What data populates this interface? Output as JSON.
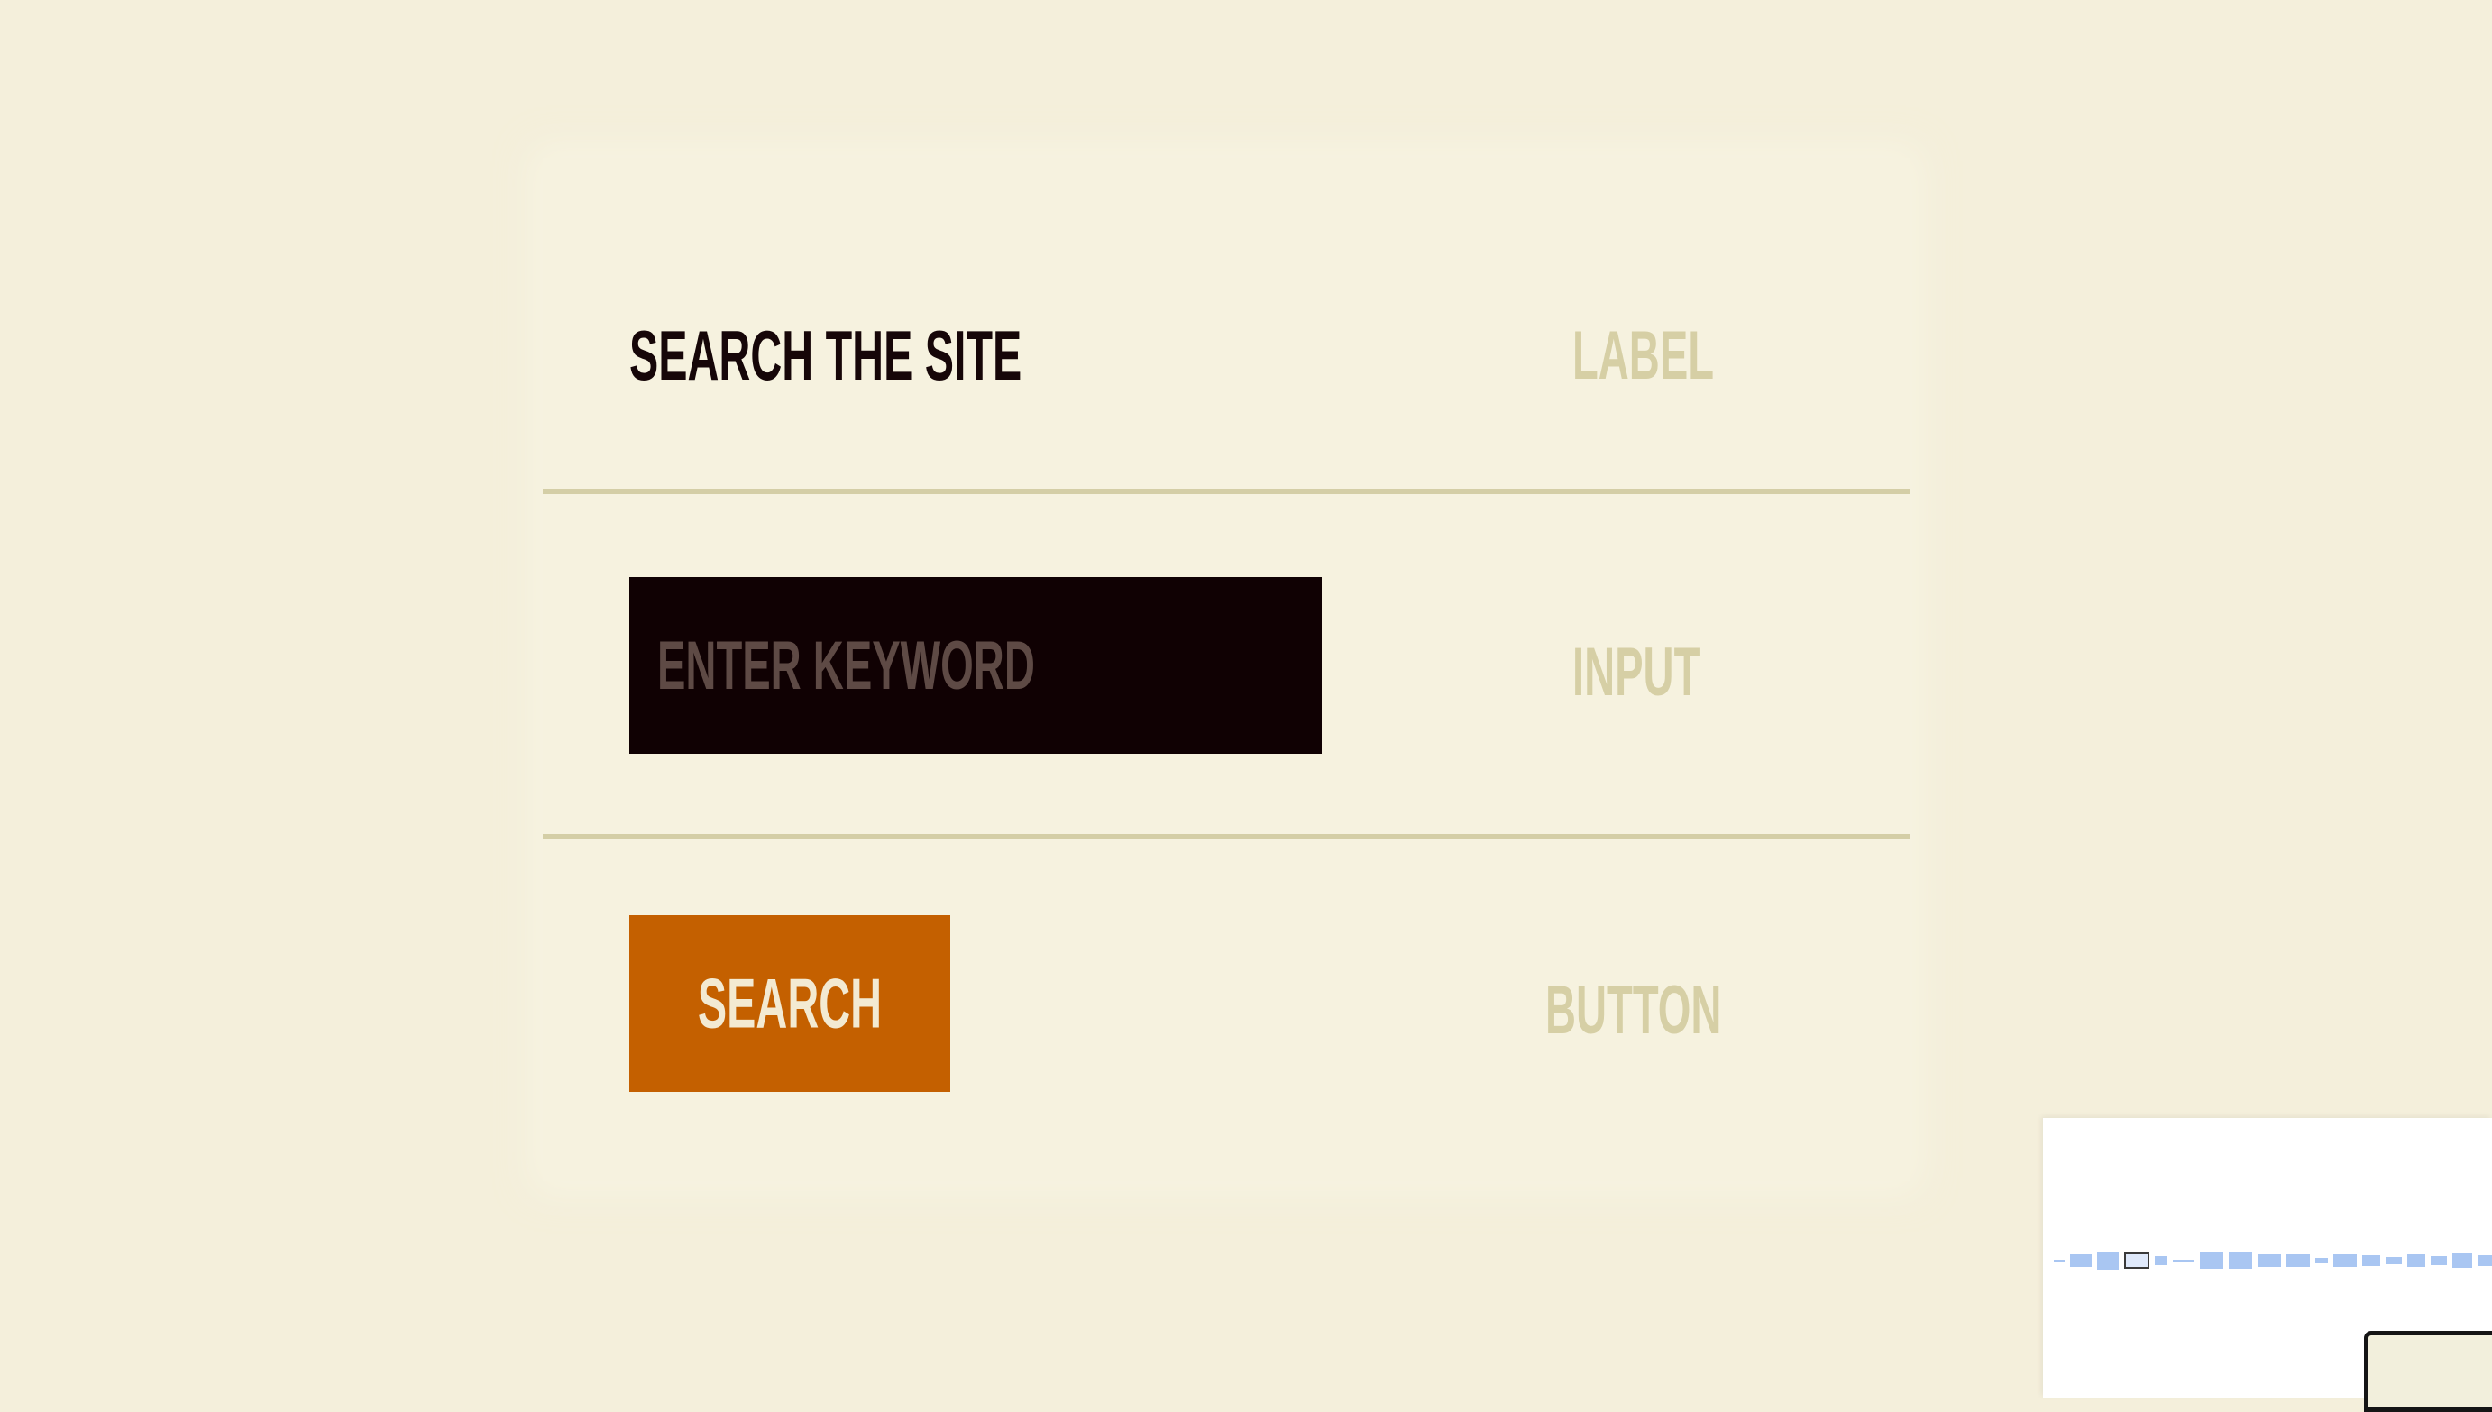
{
  "form": {
    "label_text": "SEARCH THE SITE",
    "input_placeholder": "ENTER KEYWORD",
    "input_value": "",
    "button_label": "SEARCH"
  },
  "annotations": {
    "label": "LABEL",
    "input": "INPUT",
    "button": "BUTTON"
  },
  "colors": {
    "page_background": "#f4efdb",
    "label_text": "#160608",
    "annotation_text": "#d6cfa5",
    "divider": "#d4cea6",
    "input_background": "#100103",
    "input_placeholder": "#5e4a45",
    "button_background": "#c46000",
    "button_text": "#f3ead2"
  }
}
